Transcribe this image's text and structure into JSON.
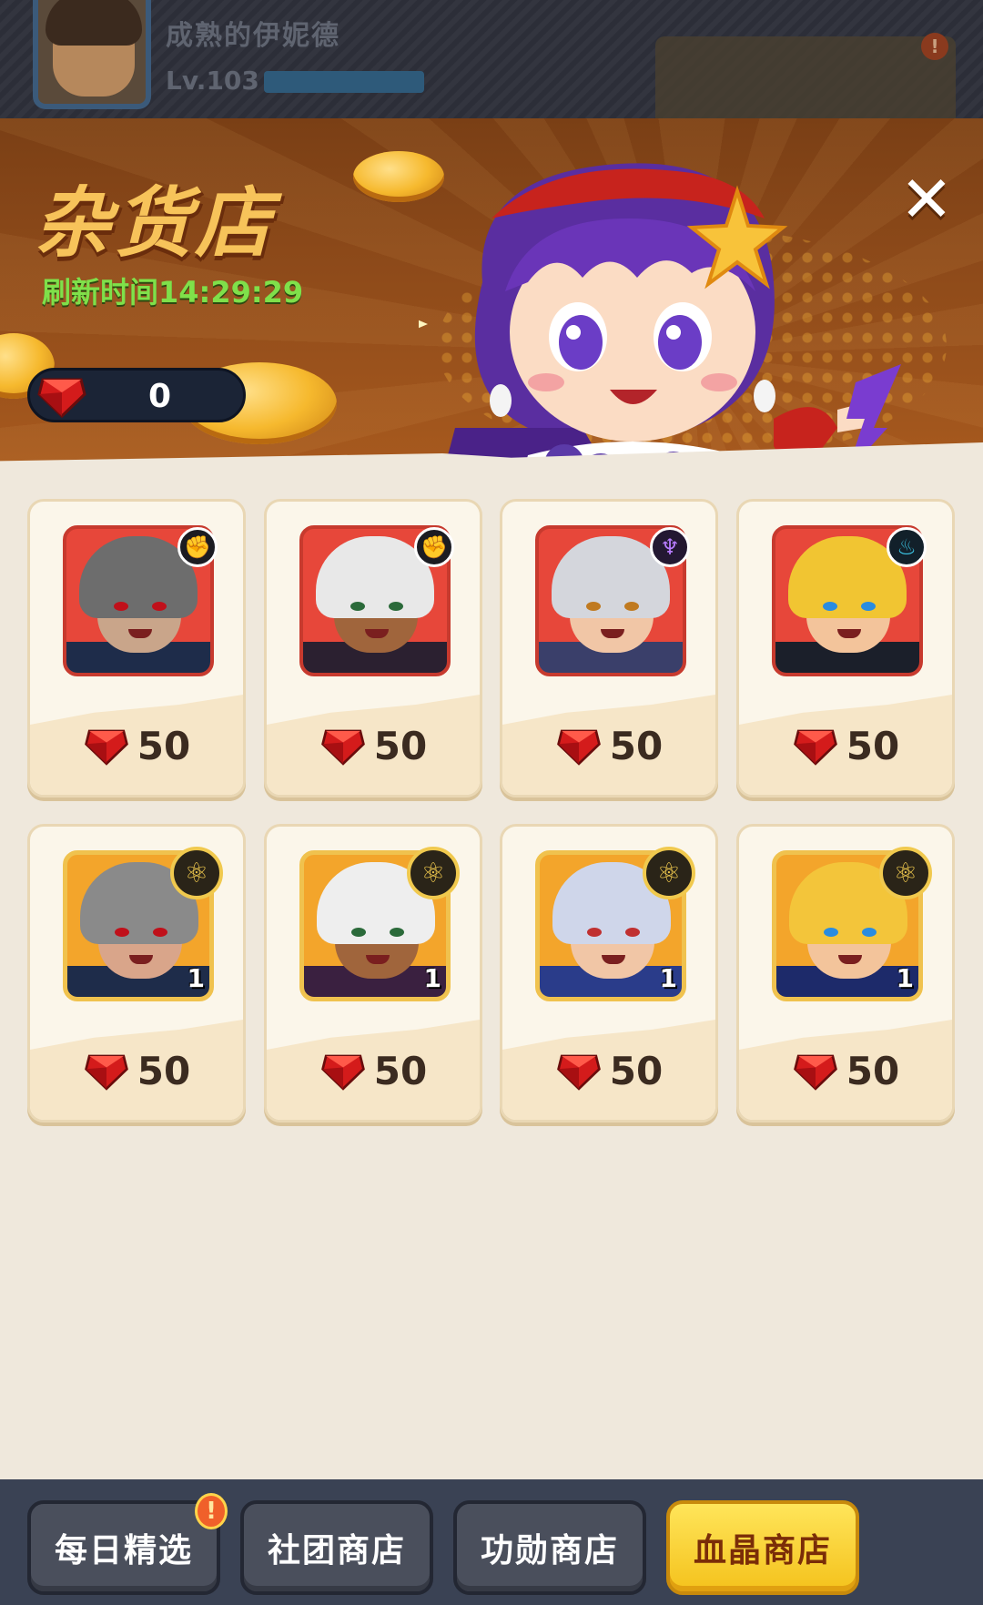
{
  "player": {
    "name": "成熟的伊妮德",
    "level": "Lv.103"
  },
  "shop": {
    "title": "杂货店",
    "refresh_label": "刷新时间14:29:29",
    "close_symbol": "✕",
    "currency_icon": "blood-crystal-icon",
    "currency_amount": "0"
  },
  "items": [
    {
      "price": "50",
      "badge": "fist-icon",
      "hair": "#6d6d6d",
      "skin": "#c9a58a",
      "body": "#1e2c4a",
      "eyes": "#c0101a"
    },
    {
      "price": "50",
      "badge": "fist-icon",
      "hair": "#e8e8e8",
      "skin": "#a0653c",
      "body": "#2b2030",
      "eyes": "#2b6a3a"
    },
    {
      "price": "50",
      "badge": "demon-icon",
      "hair": "#d4d6dc",
      "skin": "#f1c6a6",
      "body": "#3a3f6a",
      "eyes": "#c07a20"
    },
    {
      "price": "50",
      "badge": "flame-icon",
      "hair": "#f1c532",
      "skin": "#f3c49b",
      "body": "#1b1f2a",
      "eyes": "#2a8ce0"
    },
    {
      "price": "50",
      "badge": "atom-icon",
      "hair": "#8a8a8a",
      "skin": "#d9a58a",
      "body": "#1e2c4a",
      "eyes": "#c0101a",
      "count": "1"
    },
    {
      "price": "50",
      "badge": "atom-icon",
      "hair": "#eeeeee",
      "skin": "#a0653c",
      "body": "#3a2040",
      "eyes": "#2b6a3a",
      "count": "1"
    },
    {
      "price": "50",
      "badge": "atom-icon",
      "hair": "#cfd6ea",
      "skin": "#f1c6a6",
      "body": "#2a3c8a",
      "eyes": "#c03030",
      "count": "1"
    },
    {
      "price": "50",
      "badge": "atom-icon",
      "hair": "#f3c53a",
      "skin": "#f3c49b",
      "body": "#1d2a6a",
      "eyes": "#2a8ce0",
      "count": "1"
    }
  ],
  "tabs": [
    {
      "label": "每日精选",
      "active": false,
      "alert": "!"
    },
    {
      "label": "社团商店",
      "active": false
    },
    {
      "label": "功勋商店",
      "active": false
    },
    {
      "label": "血晶商店",
      "active": true
    }
  ],
  "colors": {
    "accent": "#f4c21c",
    "refresh_text": "#7fe04a",
    "title": "#f7c35a"
  }
}
